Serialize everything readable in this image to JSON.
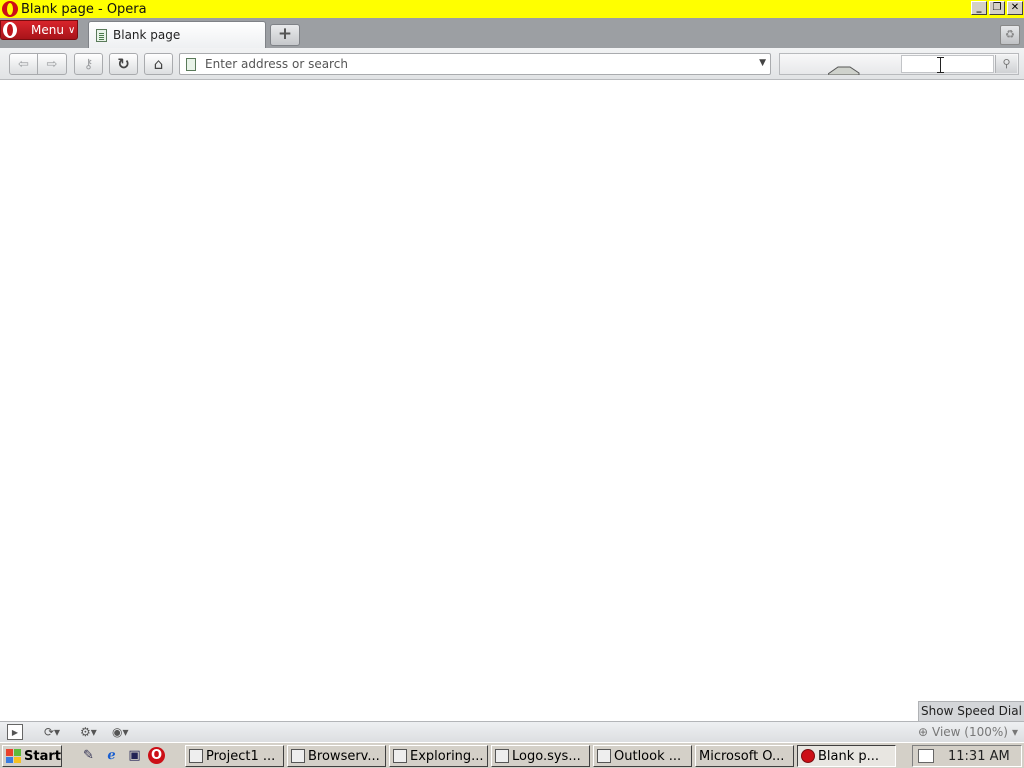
{
  "window": {
    "title": "Blank page - Opera",
    "min_glyph": "_",
    "max_glyph": "❐",
    "close_glyph": "✕"
  },
  "tabbar": {
    "menu_label": "Menu",
    "menu_chevron": "∨",
    "tabs": [
      {
        "label": "Blank page",
        "active": true
      }
    ],
    "new_tab_glyph": "+",
    "trash_glyph": "♻"
  },
  "toolbar": {
    "back_glyph": "⇦",
    "forward_glyph": "⇨",
    "key_glyph": "⚷",
    "reload_glyph": "↻",
    "home_glyph": "⌂",
    "address_placeholder": "Enter address or search",
    "address_value": "",
    "dropdown_glyph": "▼",
    "search_value": "",
    "search_go_glyph": "⚲"
  },
  "content": {
    "speed_dial_label": "Show Speed Dial"
  },
  "statusbar": {
    "panel_glyph": "▶",
    "sync_glyph": "⟳▾",
    "share_glyph": "⚙▾",
    "turbo_glyph": "◉▾",
    "zoom_label": "View (100%)",
    "zoom_glyph": "⊕",
    "zoom_chevron": "▾"
  },
  "taskbar": {
    "start_label": "Start",
    "quick_launch": [
      {
        "icon": "notepad-icon",
        "glyph": "✎"
      },
      {
        "icon": "ie-icon",
        "glyph": "ℯ"
      },
      {
        "icon": "desktop-icon",
        "glyph": "▣"
      },
      {
        "icon": "opera-icon",
        "glyph": "O"
      }
    ],
    "tasks": [
      {
        "label": "Project1 ...",
        "active": false
      },
      {
        "label": "Browserv...",
        "active": false
      },
      {
        "label": "Exploring...",
        "active": false
      },
      {
        "label": "Logo.sys...",
        "active": false
      },
      {
        "label": "Outlook ...",
        "active": false
      },
      {
        "label": "Microsoft O...",
        "active": false
      },
      {
        "label": "Blank p...",
        "active": true
      }
    ],
    "clock": "11:31 AM"
  },
  "colors": {
    "titlebar_bg": "#ffff00",
    "opera_red": "#cc0f16",
    "taskbar_bg": "#d4d0c8"
  }
}
